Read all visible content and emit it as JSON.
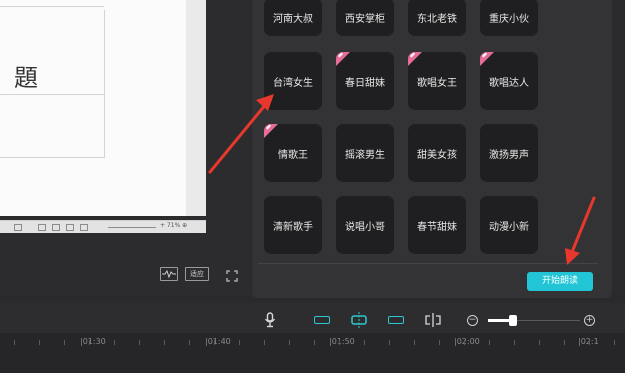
{
  "document": {
    "heading_fragment": "題",
    "zoom_text": "+ 71% ⊕"
  },
  "preview_controls": {
    "middle_label": "适应"
  },
  "voice_cards": [
    {
      "label": "河南大叔",
      "badge": false
    },
    {
      "label": "西安掌柜",
      "badge": false
    },
    {
      "label": "东北老铁",
      "badge": false
    },
    {
      "label": "重庆小伙",
      "badge": false
    },
    {
      "label": "台湾女生",
      "badge": false
    },
    {
      "label": "春日甜妹",
      "badge": true
    },
    {
      "label": "歌唱女王",
      "badge": true
    },
    {
      "label": "歌唱达人",
      "badge": true
    },
    {
      "label": "情歌王",
      "badge": true
    },
    {
      "label": "摇滚男生",
      "badge": false
    },
    {
      "label": "甜美女孩",
      "badge": false
    },
    {
      "label": "激扬男声",
      "badge": false
    },
    {
      "label": "清新歌手",
      "badge": false
    },
    {
      "label": "说唱小哥",
      "badge": false
    },
    {
      "label": "春节甜妹",
      "badge": false
    },
    {
      "label": "动漫小新",
      "badge": false
    }
  ],
  "actions": {
    "start_reading": "开始朗读"
  },
  "timeline": {
    "ticks": [
      "|01:30",
      "|01:40",
      "|01:50",
      "|02:00",
      "|02:1"
    ]
  },
  "colors": {
    "accent": "#22c5d6",
    "badge": "#e86c9a",
    "annotation": "#e8372c"
  },
  "icons": [
    "microphone-icon",
    "split-icon",
    "zoom-out-icon",
    "zoom-in-icon",
    "waveform-icon",
    "fullscreen-icon"
  ]
}
